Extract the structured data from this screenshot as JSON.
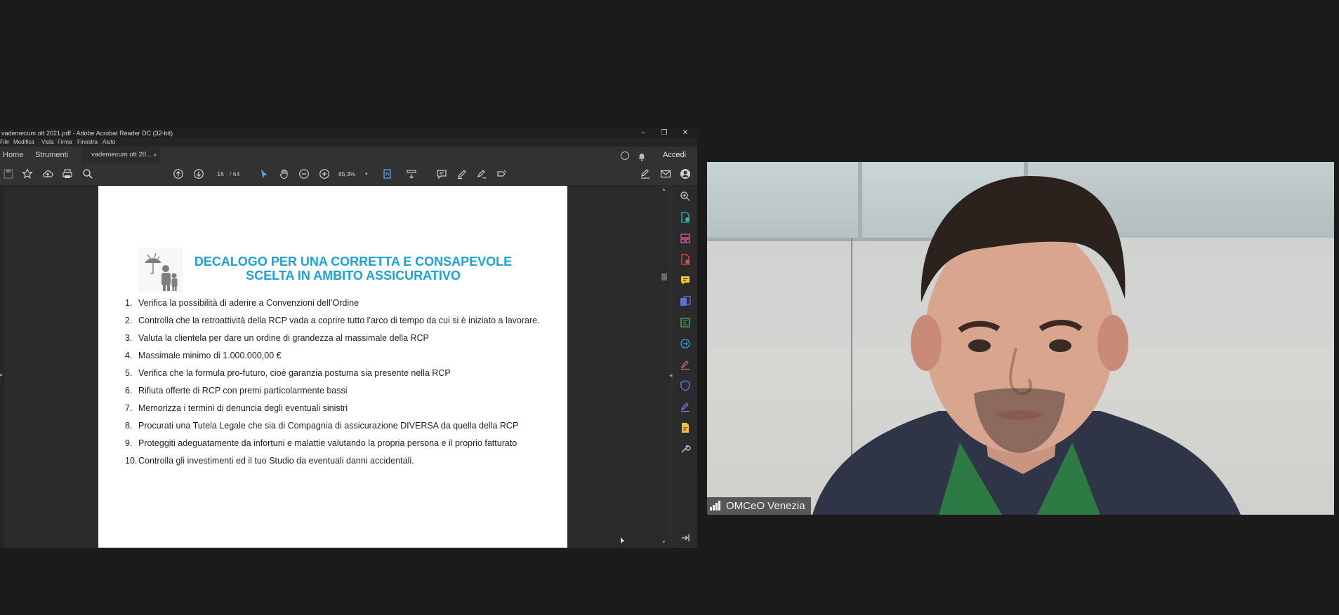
{
  "acrobat": {
    "window_title": "vademecum ott 2021.pdf - Adobe Acrobat Reader DC (32-bit)",
    "window_controls": {
      "minimize": "–",
      "restore": "❐",
      "close": "✕"
    },
    "menu": [
      "File",
      "Modifica",
      "Vista",
      "Firma",
      "Finestra",
      "Aiuto"
    ],
    "tabs": {
      "home": "Home",
      "tools": "Strumenti",
      "document": "vademecum ott 20...",
      "close": "×"
    },
    "signin": "Accedi",
    "toolbar": {
      "current_page": "16",
      "page_total": "/ 64",
      "zoom": "85,3%"
    },
    "document": {
      "title_line1": "DECALOGO PER UNA CORRETTA E CONSAPEVOLE",
      "title_line2": "SCELTA IN AMBITO ASSICURATIVO",
      "items": [
        {
          "num": "1.",
          "text": "Verifica la possibilità di aderire a Convenzioni dell’Ordine"
        },
        {
          "num": "2.",
          "text": "Controlla che la retroattività della RCP vada a coprire tutto l’arco di tempo da cui si è iniziato a lavorare."
        },
        {
          "num": "3.",
          "text": "Valuta la clientela per dare un ordine di grandezza al massimale della RCP"
        },
        {
          "num": "4.",
          "text": "Massimale minimo di 1.000.000,00 €"
        },
        {
          "num": "5.",
          "text": " Verifica che la formula pro-futuro, cioè garanzia postuma sia presente nella RCP"
        },
        {
          "num": "6.",
          "text": "Rifiuta offerte di RCP con premi particolarmente bassi"
        },
        {
          "num": "7.",
          "text": "Memorizza i termini di denuncia degli eventuali sinistri"
        },
        {
          "num": "8.",
          "text": "Procurati una Tutela Legale che sia di Compagnia di assicurazione DIVERSA da quella della RCP"
        },
        {
          "num": "9.",
          "text": "Proteggiti adeguatamente da infortuni e malattie valutando la propria persona e il proprio  fatturato"
        },
        {
          "num": "10.",
          "text": "Controlla gli investimenti ed il tuo Studio da eventuali danni accidentali."
        }
      ]
    },
    "colors": {
      "title_blue": "#1aa3d8",
      "accent_tool": "#4ea6f0"
    }
  },
  "video": {
    "participant_name": "OMCeO Venezia"
  }
}
